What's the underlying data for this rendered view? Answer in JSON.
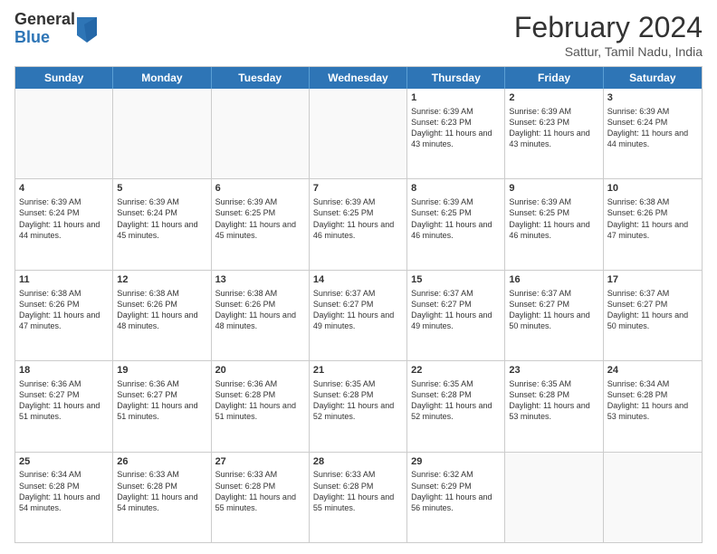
{
  "logo": {
    "general": "General",
    "blue": "Blue"
  },
  "title": "February 2024",
  "subtitle": "Sattur, Tamil Nadu, India",
  "days": [
    "Sunday",
    "Monday",
    "Tuesday",
    "Wednesday",
    "Thursday",
    "Friday",
    "Saturday"
  ],
  "weeks": [
    [
      {
        "day": "",
        "info": ""
      },
      {
        "day": "",
        "info": ""
      },
      {
        "day": "",
        "info": ""
      },
      {
        "day": "",
        "info": ""
      },
      {
        "day": "1",
        "info": "Sunrise: 6:39 AM\nSunset: 6:23 PM\nDaylight: 11 hours and 43 minutes."
      },
      {
        "day": "2",
        "info": "Sunrise: 6:39 AM\nSunset: 6:23 PM\nDaylight: 11 hours and 43 minutes."
      },
      {
        "day": "3",
        "info": "Sunrise: 6:39 AM\nSunset: 6:24 PM\nDaylight: 11 hours and 44 minutes."
      }
    ],
    [
      {
        "day": "4",
        "info": "Sunrise: 6:39 AM\nSunset: 6:24 PM\nDaylight: 11 hours and 44 minutes."
      },
      {
        "day": "5",
        "info": "Sunrise: 6:39 AM\nSunset: 6:24 PM\nDaylight: 11 hours and 45 minutes."
      },
      {
        "day": "6",
        "info": "Sunrise: 6:39 AM\nSunset: 6:25 PM\nDaylight: 11 hours and 45 minutes."
      },
      {
        "day": "7",
        "info": "Sunrise: 6:39 AM\nSunset: 6:25 PM\nDaylight: 11 hours and 46 minutes."
      },
      {
        "day": "8",
        "info": "Sunrise: 6:39 AM\nSunset: 6:25 PM\nDaylight: 11 hours and 46 minutes."
      },
      {
        "day": "9",
        "info": "Sunrise: 6:39 AM\nSunset: 6:25 PM\nDaylight: 11 hours and 46 minutes."
      },
      {
        "day": "10",
        "info": "Sunrise: 6:38 AM\nSunset: 6:26 PM\nDaylight: 11 hours and 47 minutes."
      }
    ],
    [
      {
        "day": "11",
        "info": "Sunrise: 6:38 AM\nSunset: 6:26 PM\nDaylight: 11 hours and 47 minutes."
      },
      {
        "day": "12",
        "info": "Sunrise: 6:38 AM\nSunset: 6:26 PM\nDaylight: 11 hours and 48 minutes."
      },
      {
        "day": "13",
        "info": "Sunrise: 6:38 AM\nSunset: 6:26 PM\nDaylight: 11 hours and 48 minutes."
      },
      {
        "day": "14",
        "info": "Sunrise: 6:37 AM\nSunset: 6:27 PM\nDaylight: 11 hours and 49 minutes."
      },
      {
        "day": "15",
        "info": "Sunrise: 6:37 AM\nSunset: 6:27 PM\nDaylight: 11 hours and 49 minutes."
      },
      {
        "day": "16",
        "info": "Sunrise: 6:37 AM\nSunset: 6:27 PM\nDaylight: 11 hours and 50 minutes."
      },
      {
        "day": "17",
        "info": "Sunrise: 6:37 AM\nSunset: 6:27 PM\nDaylight: 11 hours and 50 minutes."
      }
    ],
    [
      {
        "day": "18",
        "info": "Sunrise: 6:36 AM\nSunset: 6:27 PM\nDaylight: 11 hours and 51 minutes."
      },
      {
        "day": "19",
        "info": "Sunrise: 6:36 AM\nSunset: 6:27 PM\nDaylight: 11 hours and 51 minutes."
      },
      {
        "day": "20",
        "info": "Sunrise: 6:36 AM\nSunset: 6:28 PM\nDaylight: 11 hours and 51 minutes."
      },
      {
        "day": "21",
        "info": "Sunrise: 6:35 AM\nSunset: 6:28 PM\nDaylight: 11 hours and 52 minutes."
      },
      {
        "day": "22",
        "info": "Sunrise: 6:35 AM\nSunset: 6:28 PM\nDaylight: 11 hours and 52 minutes."
      },
      {
        "day": "23",
        "info": "Sunrise: 6:35 AM\nSunset: 6:28 PM\nDaylight: 11 hours and 53 minutes."
      },
      {
        "day": "24",
        "info": "Sunrise: 6:34 AM\nSunset: 6:28 PM\nDaylight: 11 hours and 53 minutes."
      }
    ],
    [
      {
        "day": "25",
        "info": "Sunrise: 6:34 AM\nSunset: 6:28 PM\nDaylight: 11 hours and 54 minutes."
      },
      {
        "day": "26",
        "info": "Sunrise: 6:33 AM\nSunset: 6:28 PM\nDaylight: 11 hours and 54 minutes."
      },
      {
        "day": "27",
        "info": "Sunrise: 6:33 AM\nSunset: 6:28 PM\nDaylight: 11 hours and 55 minutes."
      },
      {
        "day": "28",
        "info": "Sunrise: 6:33 AM\nSunset: 6:28 PM\nDaylight: 11 hours and 55 minutes."
      },
      {
        "day": "29",
        "info": "Sunrise: 6:32 AM\nSunset: 6:29 PM\nDaylight: 11 hours and 56 minutes."
      },
      {
        "day": "",
        "info": ""
      },
      {
        "day": "",
        "info": ""
      }
    ]
  ]
}
